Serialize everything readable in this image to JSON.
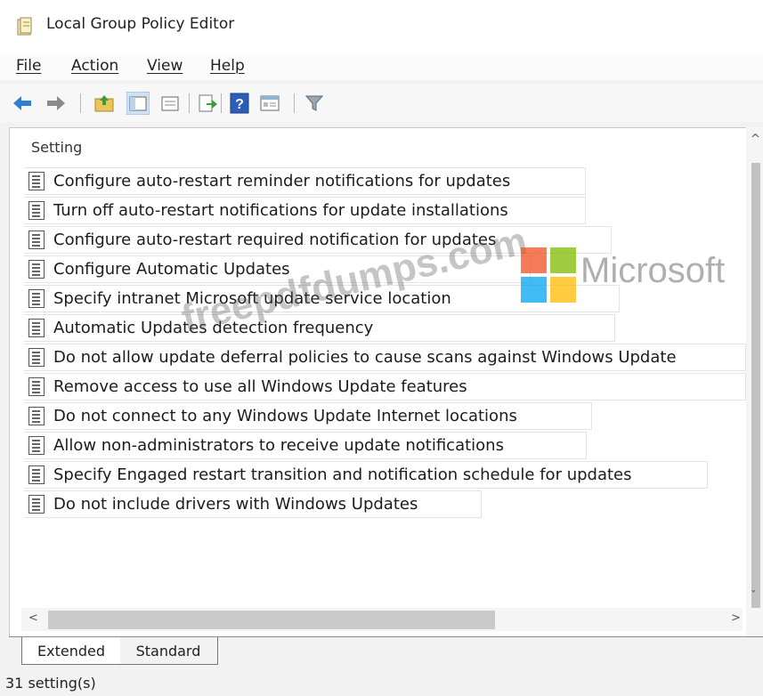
{
  "window": {
    "title": "Local Group Policy Editor",
    "icon": "group-policy-icon"
  },
  "menu": {
    "items": [
      {
        "label": "File"
      },
      {
        "label": "Action"
      },
      {
        "label": "View"
      },
      {
        "label": "Help"
      }
    ]
  },
  "toolbar": {
    "buttons": [
      {
        "icon": "back-arrow-icon"
      },
      {
        "icon": "forward-arrow-icon"
      },
      {
        "icon": "up-folder-icon"
      },
      {
        "icon": "show-hide-console-tree-icon"
      },
      {
        "icon": "export-list-icon"
      },
      {
        "icon": "help-icon"
      },
      {
        "icon": "properties-icon"
      },
      {
        "icon": "filter-icon"
      }
    ]
  },
  "list": {
    "column_header": "Setting",
    "rows": [
      {
        "label": "Configure auto-restart reminder notifications for updates"
      },
      {
        "label": "Turn off auto-restart notifications for update installations"
      },
      {
        "label": "Configure auto-restart required notification for updates"
      },
      {
        "label": "Configure Automatic Updates"
      },
      {
        "label": "Specify intranet Microsoft update service location"
      },
      {
        "label": "Automatic Updates detection frequency"
      },
      {
        "label": "Do not allow update deferral policies to cause scans against Windows Update"
      },
      {
        "label": "Remove access to use all Windows Update features"
      },
      {
        "label": "Do not connect to any Windows Update Internet locations"
      },
      {
        "label": "Allow non-administrators to receive update notifications"
      },
      {
        "label": "Specify Engaged restart transition and notification schedule for updates"
      },
      {
        "label": "Do not include drivers with Windows Updates"
      }
    ]
  },
  "watermark": {
    "site": "freepdfdumps.com",
    "brand": "Microsoft"
  },
  "tabs": [
    {
      "label": "Extended",
      "selected": true
    },
    {
      "label": "Standard",
      "selected": false
    }
  ],
  "status": {
    "text": "31 setting(s)"
  },
  "colors": {
    "ms_red": "#f25022",
    "ms_green": "#7fba00",
    "ms_blue": "#00a4ef",
    "ms_yellow": "#ffb900"
  }
}
